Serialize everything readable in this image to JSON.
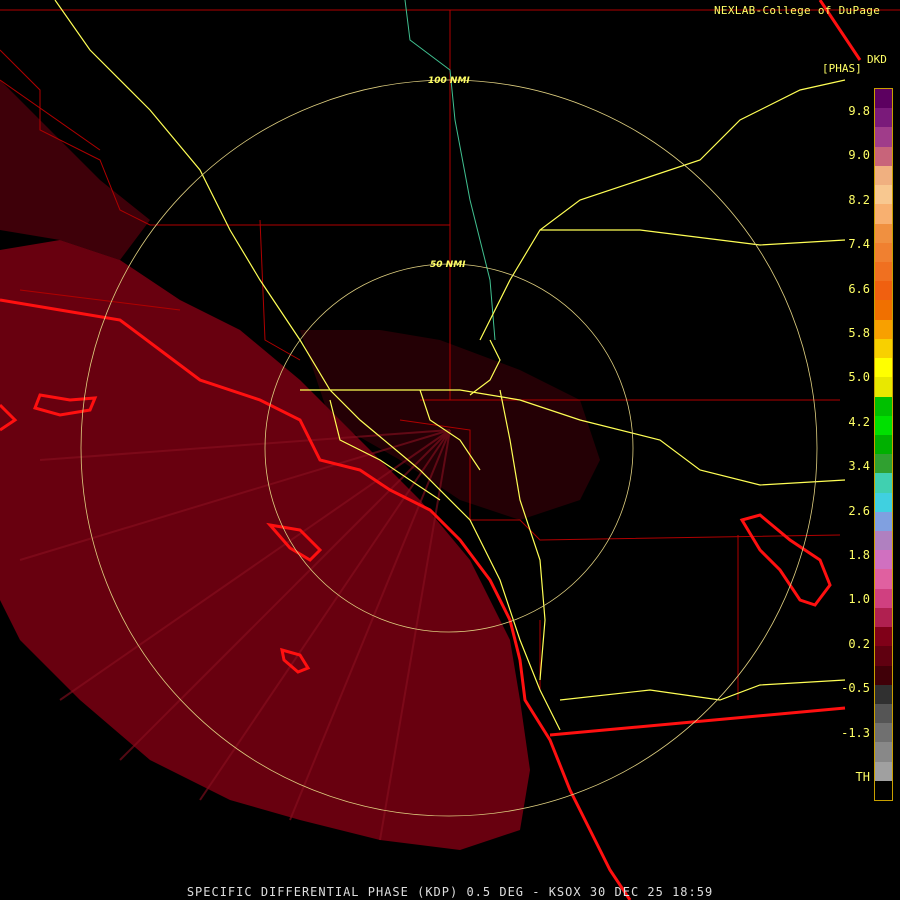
{
  "credit": "NEXLAB-College of DuPage",
  "product": {
    "code": "DKD",
    "unit": "[PHAS]"
  },
  "footer": "SPECIFIC DIFFERENTIAL PHASE (KDP) 0.5 DEG - KSOX 30 DEC 25 18:59",
  "rings": [
    {
      "label": "50 NMI"
    },
    {
      "label": "100 NMI"
    }
  ],
  "scale": {
    "ticks": [
      "9.8",
      "9.0",
      "8.2",
      "7.4",
      "6.6",
      "5.8",
      "5.0",
      "4.2",
      "3.4",
      "2.6",
      "1.8",
      "1.0",
      "0.2",
      "-0.5",
      "-1.3",
      "TH"
    ],
    "colors": [
      "#5c0060",
      "#7a1a7a",
      "#a03c8a",
      "#c8647a",
      "#f0b080",
      "#f8c890",
      "#f8b070",
      "#f09040",
      "#f08030",
      "#f07020",
      "#f06010",
      "#f07000",
      "#f8a000",
      "#f8d000",
      "#ffff00",
      "#e8e800",
      "#00c000",
      "#00e000",
      "#00b000",
      "#30a030",
      "#40d0b0",
      "#40d0e0",
      "#80a0e0",
      "#b080c0",
      "#d070c0",
      "#e060a0",
      "#d04080",
      "#b02050",
      "#800018",
      "#600010",
      "#400008",
      "#303030",
      "#555555",
      "#707070",
      "#888888",
      "#a0a0a0",
      "#000000"
    ]
  },
  "colors": {
    "echo": "#6e0010",
    "highway": "#ffff55",
    "county": "#b00000",
    "coast": "#ff1010",
    "river": "#40c090",
    "ring": "#e0d080"
  }
}
